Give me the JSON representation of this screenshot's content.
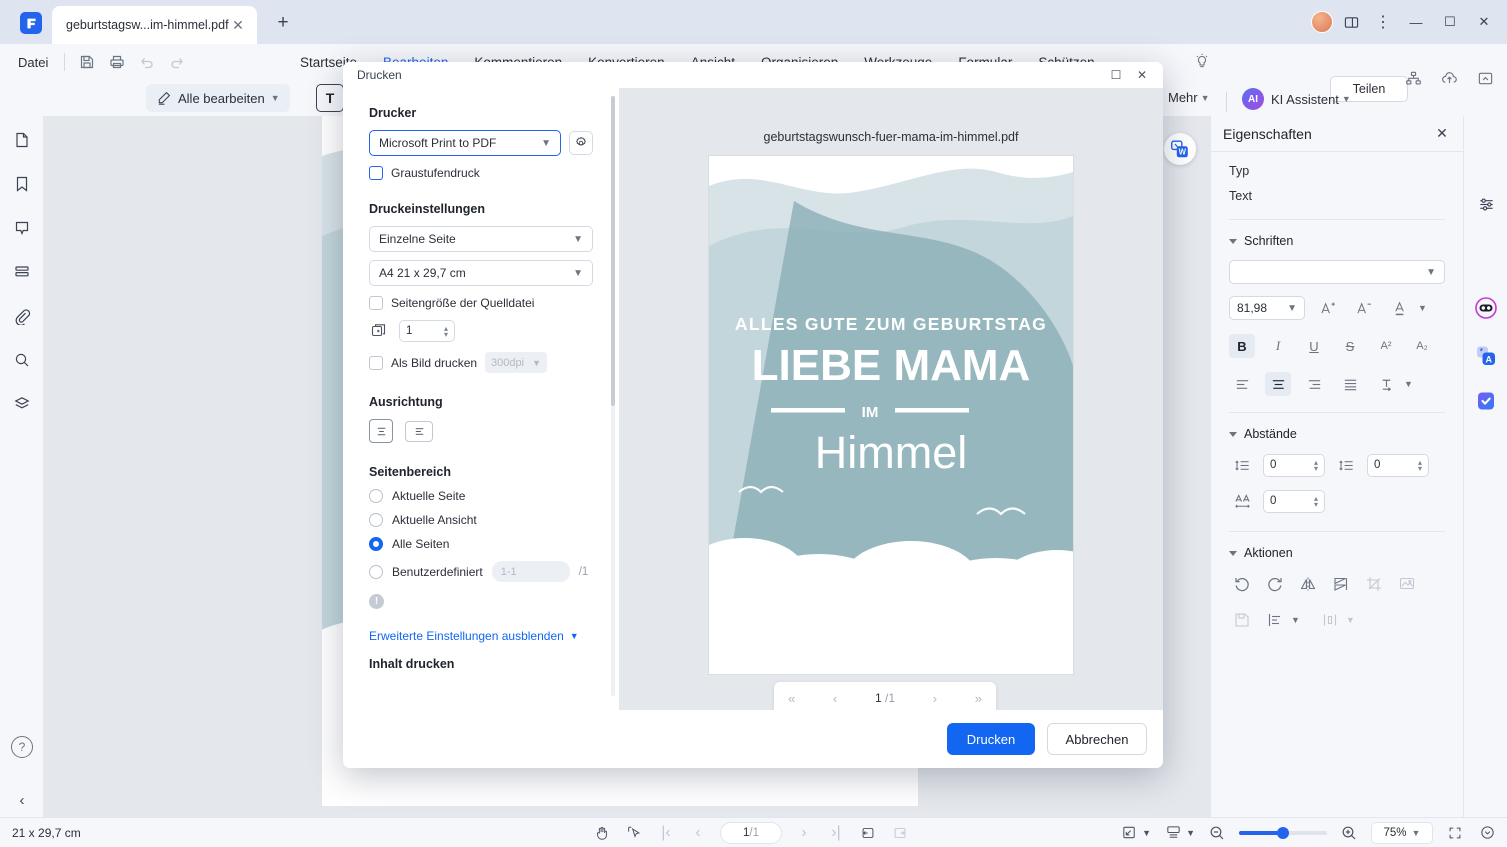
{
  "window": {
    "tab_label": "geburtstagsw...im-himmel.pdf",
    "new_tab_icon": "plus-icon",
    "close_tab_icon": "close-icon",
    "minimize_label": "—",
    "maximize_label": "☐",
    "close_label": "✕",
    "more_label": "⋮"
  },
  "menu": {
    "file_label": "Datei",
    "tabs": [
      {
        "label": "Startseite",
        "active": false
      },
      {
        "label": "Bearbeiten",
        "active": true
      },
      {
        "label": "Kommentieren",
        "active": false
      },
      {
        "label": "Konvertieren",
        "active": false
      },
      {
        "label": "Ansicht",
        "active": false
      },
      {
        "label": "Organisieren",
        "active": false
      },
      {
        "label": "Werkzeuge",
        "active": false
      },
      {
        "label": "Formular",
        "active": false
      },
      {
        "label": "Schützen",
        "active": false
      }
    ],
    "share_label": "Teilen",
    "quick_icons": [
      "save-icon",
      "print-icon",
      "undo-icon",
      "redo-icon"
    ]
  },
  "toolbar": {
    "edit_all_label": "Alle bearbeiten",
    "text_tool_label": "T",
    "more_label": "Mehr",
    "ai_badge": "AI",
    "ai_label": "KI Assistent"
  },
  "left_rail": {
    "items": [
      {
        "icon": "page-thumbnail-icon",
        "name": "sidebar-item-thumbnails"
      },
      {
        "icon": "bookmark-icon",
        "name": "sidebar-item-bookmarks"
      },
      {
        "icon": "comment-icon",
        "name": "sidebar-item-comments"
      },
      {
        "icon": "layers-list-icon",
        "name": "sidebar-item-list"
      },
      {
        "icon": "attachment-icon",
        "name": "sidebar-item-attachments"
      },
      {
        "icon": "search-icon",
        "name": "sidebar-item-search"
      },
      {
        "icon": "stack-icon",
        "name": "sidebar-item-layers"
      }
    ],
    "help_label": "?",
    "collapse_label": "‹"
  },
  "properties": {
    "title": "Eigenschaften",
    "type_label": "Typ",
    "type_value": "Text",
    "fonts_section": "Schriften",
    "font_family_value": "",
    "font_size_value": "81,98",
    "format_buttons": [
      {
        "label": "B",
        "name": "bold-button",
        "active": true
      },
      {
        "label": "I",
        "name": "italic-button",
        "active": false
      },
      {
        "label": "U",
        "name": "underline-button",
        "active": false
      },
      {
        "label": "S",
        "name": "strikethrough-button",
        "active": false
      },
      {
        "label": "A²",
        "name": "superscript-button",
        "active": false
      },
      {
        "label": "A₂",
        "name": "subscript-button",
        "active": false
      }
    ],
    "align_buttons": [
      {
        "name": "align-left-button",
        "active": false
      },
      {
        "name": "align-center-button",
        "active": true
      },
      {
        "name": "align-right-button",
        "active": false
      },
      {
        "name": "align-justify-button",
        "active": false
      },
      {
        "name": "text-direction-button",
        "active": false
      }
    ],
    "spacing_section": "Abstände",
    "line_spacing_value": "0",
    "paragraph_spacing_value": "0",
    "char_spacing_value": "0",
    "actions_section": "Aktionen",
    "action_icons": [
      "rotate-left-icon",
      "rotate-right-icon",
      "flip-horizontal-icon",
      "flip-vertical-icon",
      "crop-icon",
      "replace-image-icon",
      "save-icon",
      "align-objects-icon",
      "distribute-icon"
    ]
  },
  "right_rail": {
    "items": [
      "ai-robot-icon",
      "translate-icon",
      "check-task-icon"
    ]
  },
  "statusbar": {
    "page_size": "21 x 29,7 cm",
    "page_indicator_current": "1",
    "page_indicator_total": "/1",
    "zoom_value": "75%",
    "tools": [
      "hand-tool-icon",
      "select-tool-icon",
      "first-page-icon",
      "prev-page-icon",
      "next-page-icon",
      "last-page-icon",
      "single-page-icon",
      "continuous-page-icon"
    ],
    "right_tools": [
      "fit-mode-icon",
      "layout-mode-icon",
      "zoom-out-icon",
      "zoom-in-icon",
      "fullscreen-icon",
      "more-view-icon"
    ]
  },
  "print_dialog": {
    "title": "Drucken",
    "printer_section": "Drucker",
    "printer_value": "Microsoft Print to PDF",
    "printer_settings_icon": "gear-icon",
    "grayscale_label": "Graustufendruck",
    "grayscale_checked": false,
    "settings_section": "Druckeinstellungen",
    "page_mode_value": "Einzelne Seite",
    "paper_size_value": "A4 21 x 29,7 cm",
    "source_size_label": "Seitengröße der Quelldatei",
    "source_size_checked": false,
    "copies_value": "1",
    "print_as_image_label": "Als Bild drucken",
    "print_as_image_checked": false,
    "dpi_value": "300dpi",
    "orientation_section": "Ausrichtung",
    "orientation_portrait_selected": true,
    "page_range_section": "Seitenbereich",
    "range_options": [
      {
        "label": "Aktuelle Seite",
        "selected": false
      },
      {
        "label": "Aktuelle Ansicht",
        "selected": false
      },
      {
        "label": "Alle Seiten",
        "selected": true
      },
      {
        "label": "Benutzerdefiniert",
        "selected": false
      }
    ],
    "custom_range_placeholder": "1-1",
    "custom_range_total": "/1",
    "warning_icon": "info-icon",
    "advanced_link": "Erweiterte Einstellungen ausblenden",
    "advanced_next_section": "Inhalt drucken",
    "preview_filename": "geburtstagswunsch-fuer-mama-im-himmel.pdf",
    "preview_page_current": "1",
    "preview_page_total": "/1",
    "print_button": "Drucken",
    "cancel_button": "Abbrechen"
  },
  "document": {
    "line1": "ALLES GUTE ZUM GEBURTSTAG",
    "line2": "LIEBE MAMA",
    "line3": "IM",
    "line4": "Himmel",
    "colors": {
      "sky_light": "#d5e2e6",
      "sky_mid": "#bcd2d7",
      "sky_deep": "#84a9b1",
      "cloud": "#ffffff"
    }
  },
  "theme": {
    "accent": "#2463eb",
    "primary_button": "#1266f1",
    "titlebar_bg": "#dfe5f0",
    "panel_bg": "#f5f7fb",
    "canvas_bg": "#e4e7ec"
  }
}
